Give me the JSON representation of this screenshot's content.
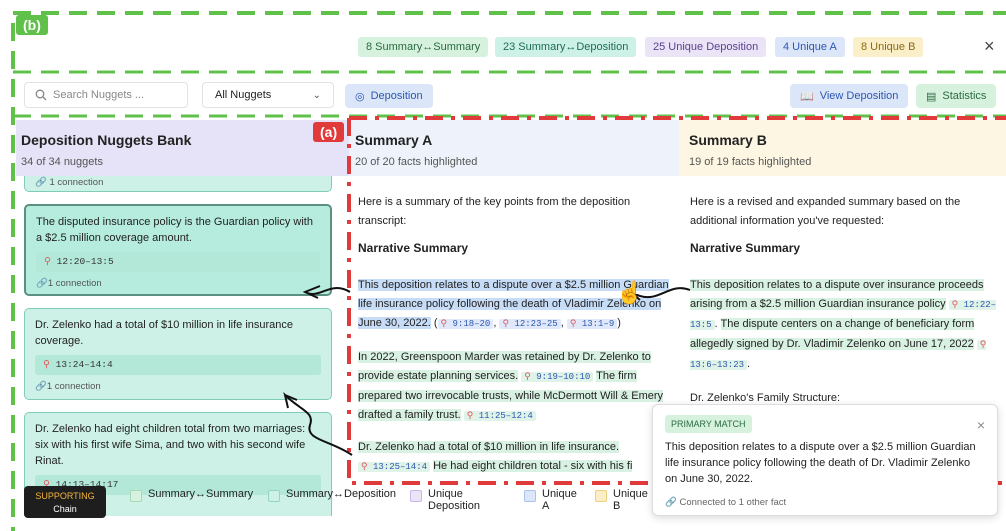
{
  "labels": {
    "b": "(b)",
    "a": "(a)"
  },
  "top_chips": [
    "8 Summary↔Summary",
    "23 Summary↔Deposition",
    "25 Unique Deposition",
    "4 Unique A",
    "8 Unique B"
  ],
  "close_glyph": "×",
  "toolbar": {
    "search_placeholder": "Search Nuggets ...",
    "filter_value": "All Nuggets",
    "deposition_toggle": "Deposition",
    "view_deposition": "View Deposition",
    "statistics": "Statistics"
  },
  "bank": {
    "title_a": "Deposition",
    "title_b": "Nuggets Bank",
    "count": "34 of 34 nuggets",
    "partial_connection": "1 connection",
    "cards": [
      {
        "text": "The disputed insurance policy is the Guardian policy with a $2.5 million coverage amount.",
        "ts": "12:20–13:5",
        "conn": "1 connection"
      },
      {
        "text": "Dr. Zelenko had a total of $10 million in life insurance coverage.",
        "ts": "13:24–14:4",
        "conn": "1 connection"
      },
      {
        "text": "Dr. Zelenko had eight children total from two marriages: six with his first wife Sima, and two with his second wife Rinat.",
        "ts": "14:13–14:17"
      }
    ]
  },
  "summary_a": {
    "title": "Summary A",
    "sub": "20 of 20 facts highlighted",
    "intro": "Here is a summary of the key points from the deposition transcript:",
    "heading": "Narrative Summary",
    "p1": "This deposition relates to a dispute over a $2.5 million Guardian life insurance policy following the death of Vladimir Zelenko on June 30, 2022.",
    "p1_ts": [
      "9:18–20",
      "12:23–25",
      "13:1–9"
    ],
    "p2a": "In 2022, Greenspoon Marder was retained by Dr. Zelenko to provide estate planning services.",
    "p2_ts1": "9:19–10:10",
    "p2b": "The firm prepared two irrevocable trusts, while McDermott Will & Emery drafted a family trust.",
    "p2_ts2": "11:25–12:4",
    "p3": "Dr. Zelenko had a total of $10 million in life insurance.",
    "p4_ts": "13:25–14:4",
    "p4": "He had eight children total - six with his fi"
  },
  "summary_b": {
    "title": "Summary B",
    "sub": "19 of 19 facts highlighted",
    "intro": "Here is a revised and expanded summary based on the additional information you've requested:",
    "heading": "Narrative Summary",
    "p1a": "This deposition relates to a dispute over insurance proceeds arising from a $2.5 million Guardian insurance policy",
    "p1_ts1": "12:22–13:5",
    "p1b": "The dispute centers on a change of beneficiary form allegedly signed by Dr. Vladimir Zelenko on June 17, 2022",
    "p1_ts2": "13:6–13:23",
    "p2": "Dr. Zelenko's Family Structure:"
  },
  "popup": {
    "tag": "PRIMARY MATCH",
    "text": "This deposition relates to a dispute over a $2.5 million Guardian life insurance policy following the death of Dr. Vladimir Zelenko on June 30, 2022.",
    "foot": "Connected to 1 other fact",
    "close": "×"
  },
  "legend": {
    "supporting_a": "SUPPORTING",
    "supporting_b": "Chain",
    "items": [
      "Summary↔Summary",
      "Summary↔Deposition",
      "Unique Deposition",
      "Unique A",
      "Unique B"
    ],
    "colors": [
      "#d6f2df",
      "#cdf1e6",
      "#ebe4f7",
      "#dbe6f9",
      "#fbefc9"
    ]
  },
  "colors": {
    "green_dash": "#5fc04a",
    "red_dash": "#e03a3a",
    "bank_bg": "#e6e2f7"
  }
}
